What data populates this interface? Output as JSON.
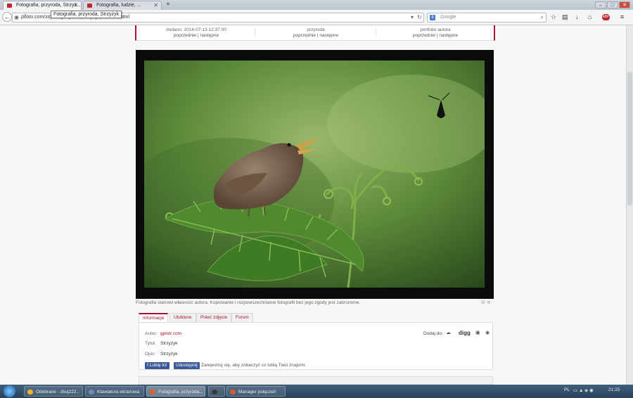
{
  "browser": {
    "tabs": [
      {
        "title": "Fotografia, przyroda, Strzyż...",
        "active": true
      },
      {
        "title": "Fotografia, ludzie, ...",
        "active": false
      }
    ],
    "tooltip": "Fotografia, przyroda, Strzyżyk",
    "url": "plfoto.com/zdjecie,przyroda,strzyzyk,xxxxxxx.html",
    "search_placeholder": "Google",
    "window_controls": {
      "minimize": "–",
      "maximize": "□",
      "close": "✕"
    }
  },
  "info_strip": {
    "columns": [
      {
        "top": "dodano: 2014-07-13 12:37:00",
        "prev": "poprzednie",
        "next": "następne"
      },
      {
        "top": "przyroda",
        "prev": "poprzednie",
        "next": "następne"
      },
      {
        "top": "portfolio autora",
        "prev": "poprzednie",
        "next": "następne"
      }
    ],
    "divider": "|"
  },
  "photo": {
    "alt": "Strzyżyk"
  },
  "copyright": "Fotografia stanowi własność autora. Kopiowanie i rozpowszechnianie fotografii bez jego zgody jest zabronione.",
  "page_tabs": [
    "Informacje",
    "Ulubione",
    "Poleć zdjęcie",
    "Forum"
  ],
  "details": {
    "author_label": "Autor:",
    "author_value": "gpiotr.com",
    "title_label": "Tytuł:",
    "title_value": "Strzyżyk",
    "desc_label": "Opis:",
    "desc_value": "Strzyżyk",
    "add_to_label": "Dodaj do:",
    "digg_label": "digg",
    "like_button": "Lubię to!",
    "share_button": "Udostępnij",
    "fb_text": "Zarejestruj się, aby zobaczyć co lubią Twoi znajomi."
  },
  "taskbar": {
    "items": [
      {
        "label": "Odebrane - zbuj222...",
        "active": false,
        "color": "#f0b428"
      },
      {
        "label": "Klawiatura ekranowa",
        "active": false,
        "color": "#6e8fb5"
      },
      {
        "label": "Fotografia, przyroda...",
        "active": true,
        "color": "#e0602a"
      },
      {
        "label": "",
        "active": false,
        "color": "#3a3a3a"
      },
      {
        "label": "Manager połączeń",
        "active": false,
        "color": "#d65c2b"
      }
    ],
    "language": "PL",
    "clock": "21:25"
  }
}
